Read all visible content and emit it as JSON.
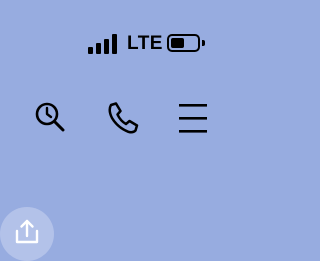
{
  "status_bar": {
    "signal_bars_filled": 4,
    "network_label": "LTE",
    "battery_level": 0.5,
    "battery_icon": "battery-icon",
    "signal_icon": "signal-strength-icon"
  },
  "toolbar": {
    "buttons": [
      {
        "name": "search-history-button",
        "icon": "search-clock-icon"
      },
      {
        "name": "phone-button",
        "icon": "phone-icon"
      },
      {
        "name": "menu-button",
        "icon": "hamburger-menu-icon"
      }
    ]
  },
  "fab": {
    "icon": "share-upload-icon"
  },
  "colors": {
    "background": "#97ace0",
    "icon": "#000000",
    "fab_background": "#b3c2e9",
    "fab_icon": "#ffffff"
  }
}
